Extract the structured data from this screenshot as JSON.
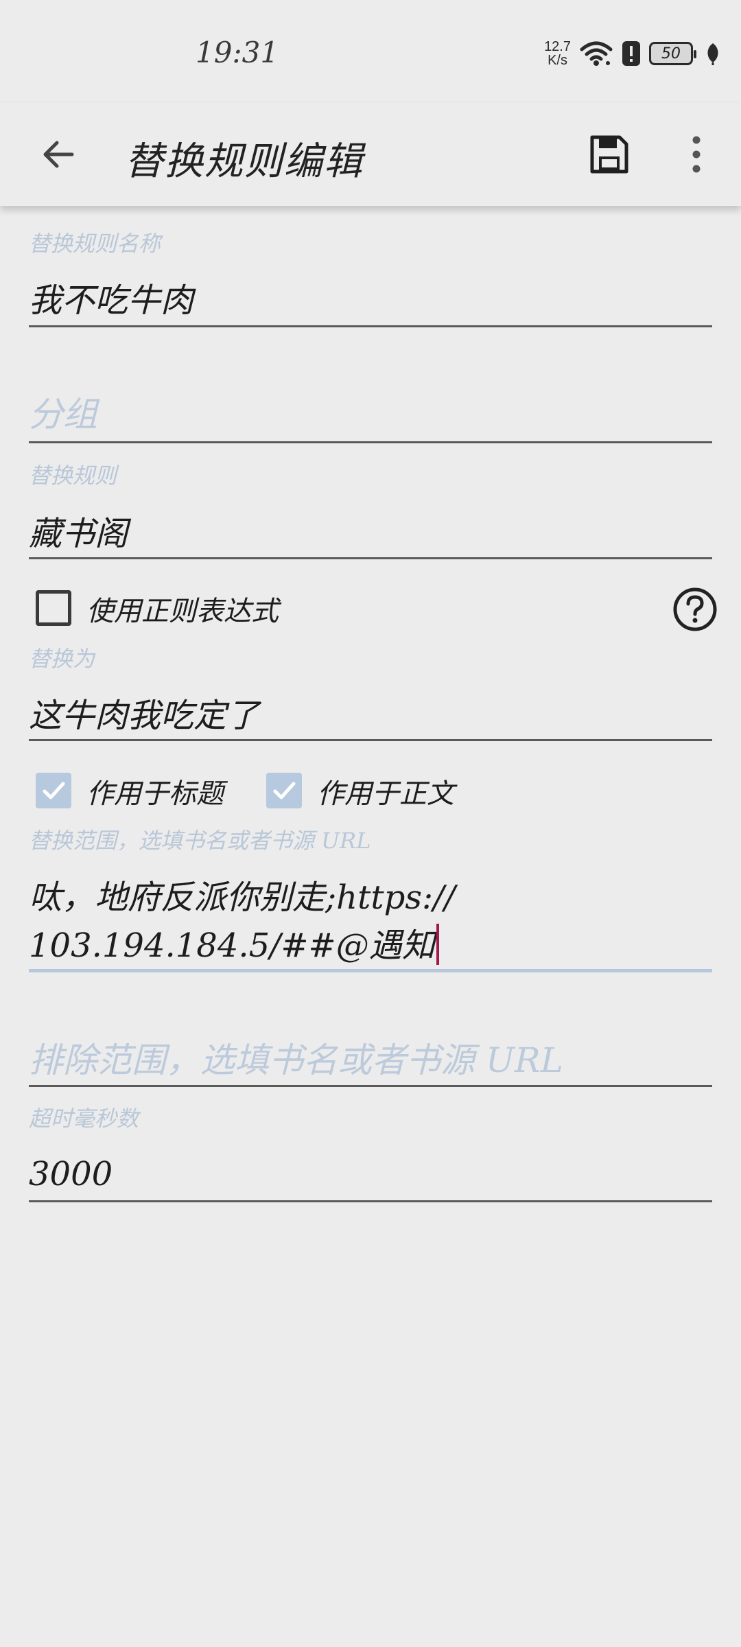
{
  "status_bar": {
    "time": "19:31",
    "net_speed_value": "12.7",
    "net_speed_unit": "K/s",
    "battery": "50"
  },
  "app_bar": {
    "title": "替换规则编辑"
  },
  "form": {
    "rule_name": {
      "label": "替换规则名称",
      "value": "我不吃牛肉"
    },
    "group": {
      "placeholder": "分组"
    },
    "pattern": {
      "label": "替换规则",
      "value": "藏书阁"
    },
    "use_regex": {
      "label": "使用正则表达式",
      "checked": false
    },
    "replacement": {
      "label": "替换为",
      "value": "这牛肉我吃定了"
    },
    "apply_title": {
      "label": "作用于标题",
      "checked": true
    },
    "apply_content": {
      "label": "作用于正文",
      "checked": true
    },
    "scope": {
      "label": "替换范围，选填书名或者书源 URL",
      "line1": "呔，地府反派你别走;https://",
      "line2": "103.194.184.5/##@遇知"
    },
    "exclude_scope": {
      "placeholder": "排除范围，选填书名或者书源 URL"
    },
    "timeout": {
      "label": "超时毫秒数",
      "value": "3000"
    }
  },
  "colors": {
    "background": "#ececec",
    "accent": "#b7c9df",
    "caret": "#a4174f"
  }
}
